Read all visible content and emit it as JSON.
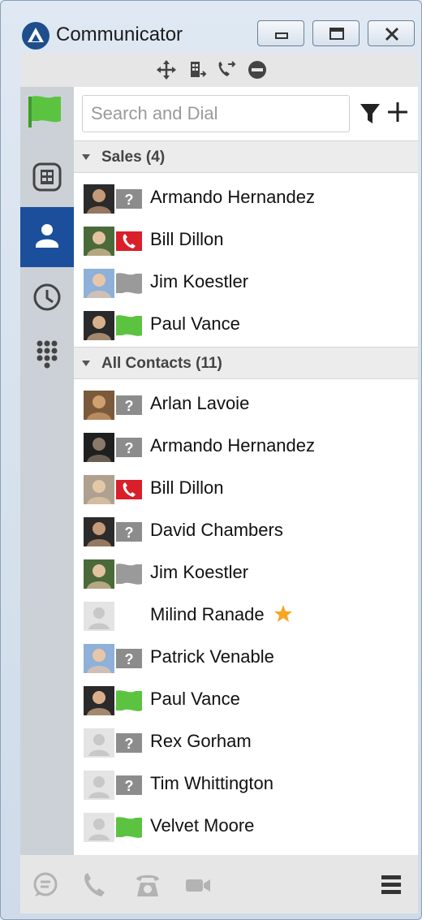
{
  "window": {
    "title": "Communicator"
  },
  "toolbar": {
    "icons": [
      "move-icon",
      "transfer-icon",
      "call-forward-icon",
      "do-not-disturb-icon"
    ]
  },
  "sidebar": {
    "items": [
      {
        "name": "presence-flag",
        "active": false
      },
      {
        "name": "directory",
        "active": false
      },
      {
        "name": "contacts",
        "active": true
      },
      {
        "name": "history",
        "active": false
      },
      {
        "name": "dialpad",
        "active": false
      }
    ]
  },
  "search": {
    "placeholder": "Search and Dial"
  },
  "colors": {
    "accent": "#1b4f9c",
    "available": "#5cc341",
    "busy": "#d91f2a",
    "unknown": "#8c8c8c",
    "star": "#f5a623"
  },
  "groups": [
    {
      "label": "Sales (4)",
      "contacts": [
        {
          "name": "Armando Hernandez",
          "status": "unknown"
        },
        {
          "name": "Bill Dillon",
          "status": "on-call"
        },
        {
          "name": "Jim Koestler",
          "status": "offline"
        },
        {
          "name": "Paul Vance",
          "status": "available"
        }
      ]
    },
    {
      "label": "All Contacts (11)",
      "contacts": [
        {
          "name": "Arlan Lavoie",
          "status": "unknown"
        },
        {
          "name": "Armando Hernandez",
          "status": "unknown"
        },
        {
          "name": "Bill Dillon",
          "status": "on-call"
        },
        {
          "name": "David Chambers",
          "status": "unknown"
        },
        {
          "name": "Jim Koestler",
          "status": "offline"
        },
        {
          "name": "Milind Ranade",
          "status": "none",
          "favorite": true
        },
        {
          "name": "Patrick Venable",
          "status": "unknown"
        },
        {
          "name": "Paul Vance",
          "status": "available"
        },
        {
          "name": "Rex Gorham",
          "status": "unknown"
        },
        {
          "name": "Tim Whittington",
          "status": "unknown"
        },
        {
          "name": "Velvet Moore",
          "status": "available"
        }
      ]
    }
  ],
  "bottombar": {
    "icons": [
      "chat-icon",
      "phone-icon",
      "desk-phone-icon",
      "video-icon",
      "menu-icon"
    ]
  }
}
